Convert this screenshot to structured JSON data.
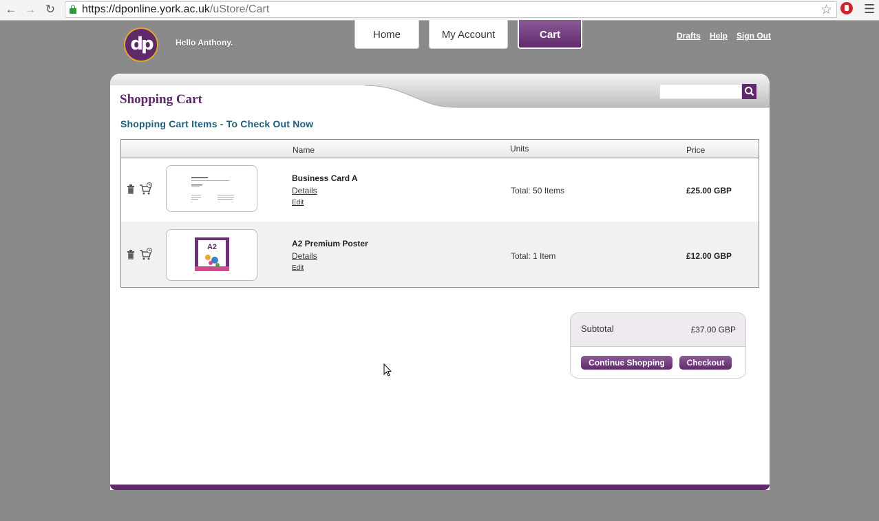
{
  "browser": {
    "url_host": "https://dponline.york.ac.uk",
    "url_path": "/uStore/Cart"
  },
  "header": {
    "logo_text": "dp",
    "greeting": "Hello Anthony.",
    "tabs": [
      {
        "label": "Home",
        "active": false
      },
      {
        "label": "My Account",
        "active": false
      },
      {
        "label": "Cart",
        "active": true
      }
    ],
    "links": [
      "Drafts",
      "Help",
      "Sign Out"
    ]
  },
  "colors": {
    "brand_purple": "#5e2a6a",
    "heading_teal": "#1f5e7a"
  },
  "page": {
    "title": "Shopping Cart",
    "subheading": "Shopping Cart Items - To Check Out Now"
  },
  "table": {
    "columns": [
      "Name",
      "Units",
      "Price"
    ],
    "rows": [
      {
        "name": "Business Card A",
        "details": "Details",
        "edit": "Edit",
        "units": "Total: 50 Items",
        "price": "£25.00 GBP",
        "thumb_icon": "business-card-thumbnail"
      },
      {
        "name": "A2 Premium Poster",
        "details": "Details",
        "edit": "Edit",
        "units": "Total: 1 Item",
        "price": "£12.00 GBP",
        "thumb_icon": "poster-thumbnail",
        "thumb_text": "A2"
      }
    ]
  },
  "summary": {
    "subtotal_label": "Subtotal",
    "subtotal_value": "£37.00 GBP",
    "continue_label": "Continue Shopping",
    "checkout_label": "Checkout"
  }
}
